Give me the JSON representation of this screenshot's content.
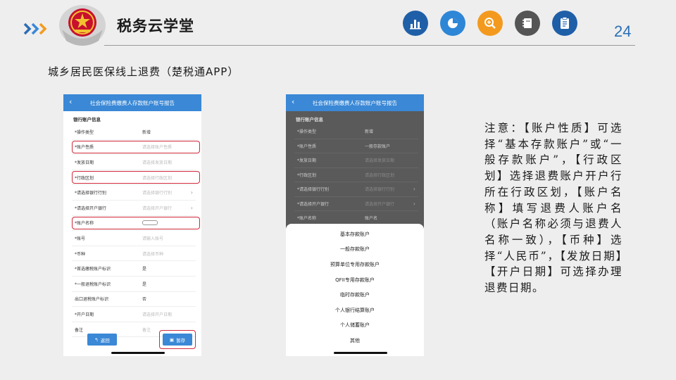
{
  "header": {
    "brand": "税务云学堂",
    "page_number": "24",
    "icons": [
      {
        "name": "bar-chart-icon",
        "color": "#1f5fa8"
      },
      {
        "name": "pie-chart-icon",
        "color": "#2e86d6"
      },
      {
        "name": "zoom-in-icon",
        "color": "#f39a1e"
      },
      {
        "name": "notebook-icon",
        "color": "#555555"
      },
      {
        "name": "checklist-icon",
        "color": "#1f5fa8"
      }
    ]
  },
  "subtitle": "城乡居民医保线上退费（楚税通APP）",
  "left_phone": {
    "title": "社会保险费缴费人存款账户账号报告",
    "section": "银行账户信息",
    "rows": [
      {
        "label": "*操作类型",
        "value": "新增"
      },
      {
        "label": "*账户性质",
        "value": "请选择账户性质"
      },
      {
        "label": "*发放日期",
        "value": "请选择发放日期"
      },
      {
        "label": "*行政区划",
        "value": "请选择行政区划"
      },
      {
        "label": "*请选择银行行别",
        "value": "请选择银行行别"
      },
      {
        "label": "*请选择开户银行",
        "value": "请选择开户银行"
      },
      {
        "label": "*账户名称",
        "value": ""
      },
      {
        "label": "*账号",
        "value": "请输入账号"
      },
      {
        "label": "*币种",
        "value": "请选择币种"
      },
      {
        "label": "*首选缴税账户标识",
        "value": "是"
      },
      {
        "label": "*一般退税账户标识",
        "value": "是"
      },
      {
        "label": "出口退税账户标识",
        "value": "否"
      },
      {
        "label": "*开户日期",
        "value": "请选择开户日期"
      },
      {
        "label": "备注",
        "value": "备注"
      }
    ],
    "back_button": "返回",
    "save_button": "暂存"
  },
  "right_phone": {
    "title": "社会保险费缴费人存款账户账号报告",
    "section": "银行账户信息",
    "rows": [
      {
        "label": "*操作类型",
        "value": "新增"
      },
      {
        "label": "*账户性质",
        "value": "一般存款账户"
      },
      {
        "label": "*发放日期",
        "value": "请选择发放日期"
      },
      {
        "label": "*行政区划",
        "value": "请选择行政区划"
      },
      {
        "label": "*请选择银行行别",
        "value": "请选择银行行别"
      },
      {
        "label": "*请选择开户银行",
        "value": "请选择开户银行"
      },
      {
        "label": "*账户名称",
        "value": "账户名"
      }
    ],
    "options": [
      "基本存款账户",
      "一般存款账户",
      "预算单位专用存款账户",
      "QFII专用存款账户",
      "临时存款账户",
      "个人银行结算账户",
      "个人储蓄账户",
      "其他"
    ]
  },
  "note": "注意：【账户性质】可选择“基本存款账户”或“一般存款账户”，【行政区划】选择退费账户开户行所在行政区划，【账户名称】填写退费人账户名（账户名称必须与退费人名称一致），【币种】选择“人民币”，【发放日期】【开户日期】可选择办理退费日期。"
}
